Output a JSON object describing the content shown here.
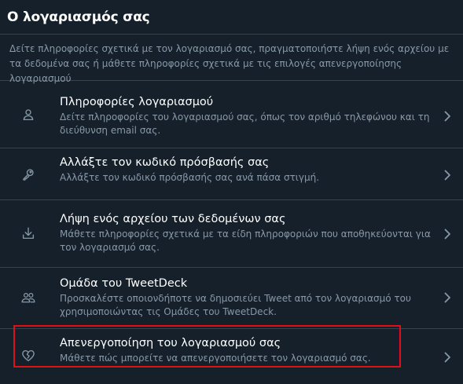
{
  "header": {
    "title": "Ο λογαριασμός σας"
  },
  "description": "Δείτε πληροφορίες σχετικά με τον λογαριασμό σας, πραγματοποιήστε λήψη ενός αρχείου με τα δεδομένα σας ή μάθετε πληροφορίες σχετικά με τις επιλογές απενεργοποίησης λογαριασμού",
  "items": [
    {
      "title": "Πληροφορίες λογαριασμού",
      "subtitle": "Δείτε πληροφορίες του λογαριασμού σας, όπως τον αριθμό τηλεφώνου και τη διεύθυνση email σας.",
      "icon": "person-icon"
    },
    {
      "title": "Αλλάξτε τον κωδικό πρόσβασής σας",
      "subtitle": "Αλλάξτε τον κωδικό πρόσβασής σας ανά πάσα στιγμή.",
      "icon": "key-icon"
    },
    {
      "title": "Λήψη ενός αρχείου των δεδομένων σας",
      "subtitle": "Μάθετε πληροφορίες σχετικά με τα είδη πληροφοριών που αποθηκεύονται για τον λογαριασμό σας.",
      "icon": "download-icon"
    },
    {
      "title": "Ομάδα του TweetDeck",
      "subtitle": "Προσκαλέστε οποιονδήποτε να δημοσιεύει Tweet από τον λογαριασμό του χρησιμοποιώντας τις Ομάδες του TweetDeck.",
      "icon": "people-icon"
    },
    {
      "title": "Απενεργοποίηση του λογαριασμού σας",
      "subtitle": "Μάθετε πώς μπορείτε να απενεργοποιήσετε τον λογαριασμό σας.",
      "icon": "broken-heart-icon"
    }
  ],
  "colors": {
    "background": "#15202b",
    "border": "#38444d",
    "secondary_text": "#8899a6",
    "highlight": "#e0101a"
  }
}
